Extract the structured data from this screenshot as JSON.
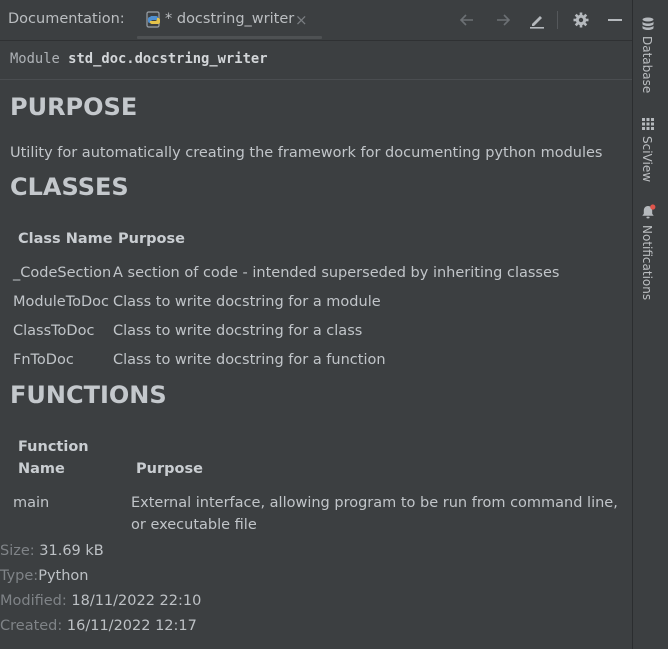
{
  "header": {
    "label": "Documentation:",
    "tab_title": "* docstring_writer",
    "tab_close": "×"
  },
  "toolbar": {
    "icons": [
      "arrow-left-icon",
      "arrow-right-icon",
      "edit-icon",
      "gear-icon",
      "minimize-icon"
    ]
  },
  "doc": {
    "module_prefix": "Module",
    "module_name": "std_doc.docstring_writer",
    "purpose_heading": "PURPOSE",
    "purpose_text": "Utility for automatically creating the framework for documenting python modules",
    "classes_heading": "CLASSES",
    "classes_table": {
      "headers": [
        "Class Name",
        "Purpose"
      ],
      "rows": [
        [
          "_CodeSection",
          "A section of code - intended superseded by inheriting classes"
        ],
        [
          "ModuleToDoc",
          "Class to write docstring for a module"
        ],
        [
          "ClassToDoc",
          "Class to write docstring for a class"
        ],
        [
          "FnToDoc",
          "Class to write docstring for a function"
        ]
      ]
    },
    "functions_heading": "FUNCTIONS",
    "functions_table": {
      "headers": [
        "Function",
        "Name",
        "Purpose"
      ],
      "rows": [
        [
          "main",
          "External interface, allowing program to be run from command line,",
          "or executable file"
        ]
      ]
    }
  },
  "meta": {
    "size_label": "Size:",
    "size_value": "31.69 kB",
    "type_label": "Type:",
    "type_value": "Python",
    "modified_label": "Modified:",
    "modified_value": "18/11/2022 22:10",
    "created_label": "Created:",
    "created_value": "16/11/2022 12:17"
  },
  "side_strip": {
    "items": [
      {
        "label": "Database",
        "icon": "database-icon"
      },
      {
        "label": "SciView",
        "icon": "sciview-icon"
      },
      {
        "label": "Notifications",
        "icon": "bell-icon"
      }
    ]
  },
  "colors": {
    "background": "#3c3f41",
    "text": "#c1c5c9",
    "muted": "#7f8387",
    "notification_dot": "#e0554b"
  }
}
